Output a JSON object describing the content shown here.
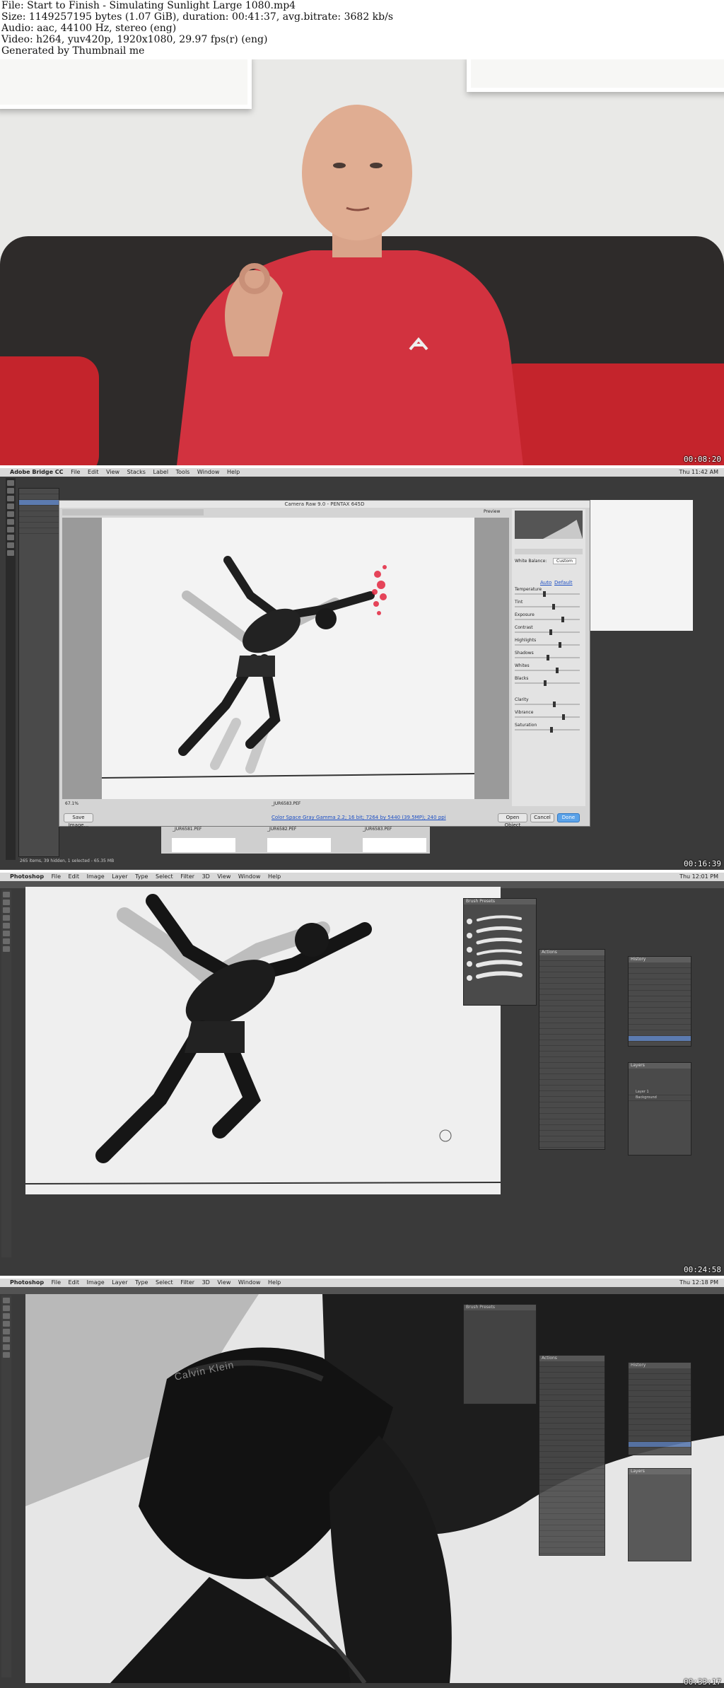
{
  "header": {
    "line1": "File: Start to Finish - Simulating Sunlight Large 1080.mp4",
    "line2": "Size: 1149257195 bytes (1.07 GiB), duration: 00:41:37, avg.bitrate: 3682 kb/s",
    "line3": "Audio: aac, 44100 Hz, stereo (eng)",
    "line4": "Video: h264, yuv420p, 1920x1080, 29.97 fps(r) (eng)",
    "line5": "Generated by Thumbnail me"
  },
  "frames": [
    {
      "timestamp": "00:08:20"
    },
    {
      "timestamp": "00:16:39",
      "menubar": {
        "app": "Adobe Bridge CC",
        "items": [
          "File",
          "Edit",
          "View",
          "Stacks",
          "Label",
          "Tools",
          "Window",
          "Help"
        ],
        "right": "Thu 11:42 AM"
      },
      "dialog": {
        "title": "Camera Raw 9.0 - PENTAX 645D",
        "filename": "_JUR6583.PEF",
        "zoom": "67.1%",
        "preview_label": "Preview",
        "white_balance_label": "White Balance:",
        "white_balance_value": "Custom",
        "auto_label": "Auto",
        "default_label": "Default",
        "sliders": [
          "Temperature",
          "Tint",
          "Exposure",
          "Contrast",
          "Highlights",
          "Shadows",
          "Whites",
          "Blacks",
          "Clarity",
          "Vibrance",
          "Saturation"
        ],
        "save_button": "Save Image...",
        "info_link": "Color Space Gray Gamma 2.2; 16 bit; 7264 by 5440 (39.5MP); 240 ppi",
        "open_button": "Open Object",
        "cancel_button": "Cancel",
        "done_button": "Done"
      },
      "thumbs": [
        "_JUR6581.PEF",
        "_JUR6582.PEF",
        "_JUR6583.PEF"
      ],
      "status": "265 items, 39 hidden, 1 selected - 65.35 MB"
    },
    {
      "timestamp": "00:24:58",
      "menubar": {
        "app": "Photoshop",
        "items": [
          "File",
          "Edit",
          "Image",
          "Layer",
          "Type",
          "Select",
          "Filter",
          "3D",
          "View",
          "Window",
          "Help"
        ],
        "right": "Thu 12:01 PM"
      },
      "panels": {
        "brush_title": "Brush Presets",
        "actions_title": "Actions",
        "history_title": "History",
        "layers_title": "Layers",
        "layer_names": [
          "Layer 1",
          "Background"
        ]
      }
    },
    {
      "timestamp": "00:33:17",
      "menubar": {
        "app": "Photoshop",
        "items": [
          "File",
          "Edit",
          "Image",
          "Layer",
          "Type",
          "Select",
          "Filter",
          "3D",
          "View",
          "Window",
          "Help"
        ],
        "right": "Thu 12:18 PM"
      },
      "waistband": "Calvin Klein"
    }
  ],
  "colors": {
    "shirt": "#d2323f",
    "sofa": "#2e2b2a",
    "ps_bg": "#3a3a3a",
    "accent_blue": "#5ba2e8"
  }
}
